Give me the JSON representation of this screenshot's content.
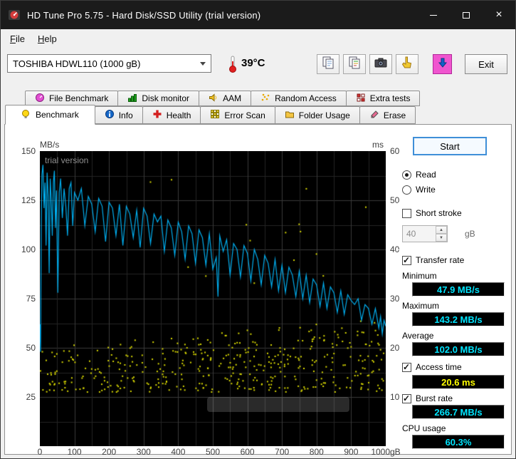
{
  "window": {
    "title": "HD Tune Pro 5.75 - Hard Disk/SSD Utility (trial version)"
  },
  "menu": {
    "file": {
      "accel": "F",
      "rest": "ile"
    },
    "help": {
      "accel": "H",
      "rest": "elp"
    }
  },
  "toolbar": {
    "drive_select": "TOSHIBA HDWL110 (1000 gB)",
    "temperature": "39°C",
    "exit_label": "Exit"
  },
  "icons": {
    "app-icon": "hd-tune-gauge",
    "thermometer-icon": "thermometer",
    "copy-screenshot-icon": "copy-pages",
    "copy-text-icon": "copy-pages-color",
    "save-screenshot-icon": "camera",
    "pointer-hand-icon": "hand",
    "save-results-icon": "down-arrow",
    "chevron-down-icon": "▾",
    "spinner_up": "▲",
    "spinner_down": "▼",
    "check": "✓",
    "close": "×"
  },
  "tabs": {
    "row1": [
      {
        "label": "File Benchmark",
        "icon": "gauge"
      },
      {
        "label": "Disk monitor",
        "icon": "bars"
      },
      {
        "label": "AAM",
        "icon": "speaker"
      },
      {
        "label": "Random Access",
        "icon": "dots"
      },
      {
        "label": "Extra tests",
        "icon": "grid"
      }
    ],
    "row2": [
      {
        "label": "Benchmark",
        "icon": "lamp",
        "active": true
      },
      {
        "label": "Info",
        "icon": "info"
      },
      {
        "label": "Health",
        "icon": "cross"
      },
      {
        "label": "Error Scan",
        "icon": "scan"
      },
      {
        "label": "Folder Usage",
        "icon": "folder"
      },
      {
        "label": "Erase",
        "icon": "eraser"
      }
    ]
  },
  "controls": {
    "start_label": "Start",
    "read_label": "Read",
    "write_label": "Write",
    "short_stroke_label": "Short stroke",
    "short_stroke_value": "40",
    "short_stroke_unit": "gB",
    "transfer_rate_label": "Transfer rate",
    "minimum_label": "Minimum",
    "minimum_value": "47.9 MB/s",
    "maximum_label": "Maximum",
    "maximum_value": "143.2 MB/s",
    "average_label": "Average",
    "average_value": "102.0 MB/s",
    "access_time_label": "Access time",
    "access_time_value": "20.6 ms",
    "burst_rate_label": "Burst rate",
    "burst_rate_value": "266.7 MB/s",
    "cpu_usage_label": "CPU usage",
    "cpu_usage_value": "60.3%"
  },
  "states": {
    "read_selected": true,
    "write_selected": false,
    "short_stroke_checked": false,
    "transfer_rate_checked": true,
    "access_time_checked": true,
    "burst_rate_checked": true
  },
  "colors": {
    "accent_blue": "#0078d7",
    "value_cyan": "#00e5ff",
    "value_yellow": "#ffff00",
    "line_blue": "#00aeef",
    "scatter_yellow": "#d8d800"
  },
  "chart_data": {
    "type": "line+scatter",
    "watermark": "trial version",
    "y_left_label": "MB/s",
    "y_right_label": "ms",
    "x_unit": "gB",
    "x_range": [
      0,
      1000
    ],
    "y_left_range": [
      0,
      150
    ],
    "y_right_range": [
      0,
      60
    ],
    "x_ticks": [
      0,
      100,
      200,
      300,
      400,
      500,
      600,
      700,
      800,
      900,
      1000
    ],
    "y_left_ticks": [
      150,
      125,
      100,
      75,
      50,
      25
    ],
    "y_right_ticks": [
      60,
      50,
      40,
      30,
      20,
      10
    ],
    "grid": {
      "x_minor": 50,
      "x_major": 100,
      "y_minor": 12.5,
      "y_major": 25,
      "on": true
    },
    "legend": "none",
    "series": [
      {
        "name": "Transfer rate",
        "type": "line",
        "axis": "left",
        "unit": "MB/s",
        "color": "#00aeef",
        "points": [
          [
            0,
            62
          ],
          [
            2,
            48
          ],
          [
            4,
            112
          ],
          [
            6,
            138
          ],
          [
            9,
            143
          ],
          [
            12,
            121
          ],
          [
            15,
            134
          ],
          [
            18,
            102
          ],
          [
            21,
            139
          ],
          [
            24,
            127
          ],
          [
            27,
            88
          ],
          [
            30,
            136
          ],
          [
            33,
            125
          ],
          [
            36,
            107
          ],
          [
            39,
            134
          ],
          [
            42,
            140
          ],
          [
            45,
            111
          ],
          [
            48,
            130
          ],
          [
            52,
            78
          ],
          [
            56,
            129
          ],
          [
            60,
            136
          ],
          [
            65,
            116
          ],
          [
            70,
            131
          ],
          [
            75,
            122
          ],
          [
            80,
            107
          ],
          [
            85,
            131
          ],
          [
            90,
            134
          ],
          [
            95,
            112
          ],
          [
            100,
            129
          ],
          [
            110,
            125
          ],
          [
            120,
            131
          ],
          [
            130,
            112
          ],
          [
            140,
            127
          ],
          [
            150,
            123
          ],
          [
            160,
            109
          ],
          [
            170,
            126
          ],
          [
            180,
            122
          ],
          [
            190,
            104
          ],
          [
            200,
            124
          ],
          [
            210,
            121
          ],
          [
            220,
            107
          ],
          [
            230,
            123
          ],
          [
            240,
            102
          ],
          [
            250,
            122
          ],
          [
            260,
            118
          ],
          [
            270,
            106
          ],
          [
            280,
            120
          ],
          [
            290,
            101
          ],
          [
            300,
            121
          ],
          [
            310,
            117
          ],
          [
            320,
            103
          ],
          [
            330,
            118
          ],
          [
            340,
            114
          ],
          [
            350,
            117
          ],
          [
            360,
            99
          ],
          [
            370,
            115
          ],
          [
            380,
            111
          ],
          [
            390,
            97
          ],
          [
            400,
            114
          ],
          [
            410,
            109
          ],
          [
            420,
            95
          ],
          [
            430,
            112
          ],
          [
            440,
            108
          ],
          [
            450,
            93
          ],
          [
            460,
            110
          ],
          [
            470,
            106
          ],
          [
            480,
            92
          ],
          [
            490,
            108
          ],
          [
            500,
            90
          ],
          [
            510,
            96
          ],
          [
            515,
            76
          ],
          [
            520,
            107
          ],
          [
            530,
            99
          ],
          [
            540,
            105
          ],
          [
            550,
            87
          ],
          [
            560,
            103
          ],
          [
            570,
            100
          ],
          [
            580,
            86
          ],
          [
            590,
            102
          ],
          [
            600,
            98
          ],
          [
            610,
            84
          ],
          [
            620,
            100
          ],
          [
            630,
            95
          ],
          [
            640,
            82
          ],
          [
            650,
            97
          ],
          [
            660,
            93
          ],
          [
            670,
            81
          ],
          [
            680,
            95
          ],
          [
            690,
            79
          ],
          [
            700,
            92
          ],
          [
            710,
            78
          ],
          [
            720,
            91
          ],
          [
            730,
            87
          ],
          [
            740,
            76
          ],
          [
            750,
            89
          ],
          [
            760,
            75
          ],
          [
            770,
            87
          ],
          [
            780,
            73
          ],
          [
            790,
            85
          ],
          [
            800,
            82
          ],
          [
            810,
            71
          ],
          [
            820,
            83
          ],
          [
            830,
            70
          ],
          [
            840,
            81
          ],
          [
            850,
            78
          ],
          [
            860,
            68
          ],
          [
            870,
            79
          ],
          [
            880,
            67
          ],
          [
            890,
            77
          ],
          [
            900,
            74
          ],
          [
            910,
            72
          ],
          [
            920,
            75
          ],
          [
            930,
            64
          ],
          [
            940,
            72
          ],
          [
            950,
            70
          ],
          [
            960,
            62
          ],
          [
            970,
            70
          ],
          [
            980,
            60
          ],
          [
            985,
            66
          ],
          [
            990,
            57
          ],
          [
            995,
            64
          ],
          [
            1000,
            61
          ]
        ]
      },
      {
        "name": "Access time",
        "type": "scatter",
        "axis": "right",
        "unit": "ms",
        "color": "#d8d800",
        "band": {
          "count": 430,
          "y_min": 11,
          "spread_start": 9,
          "spread_end": 15,
          "bias": 1.4,
          "seed": 20181102,
          "outliers": {
            "count": 15,
            "x_min": 250,
            "x_max": 950,
            "y_min": 28,
            "y_max": 55
          }
        }
      }
    ]
  }
}
